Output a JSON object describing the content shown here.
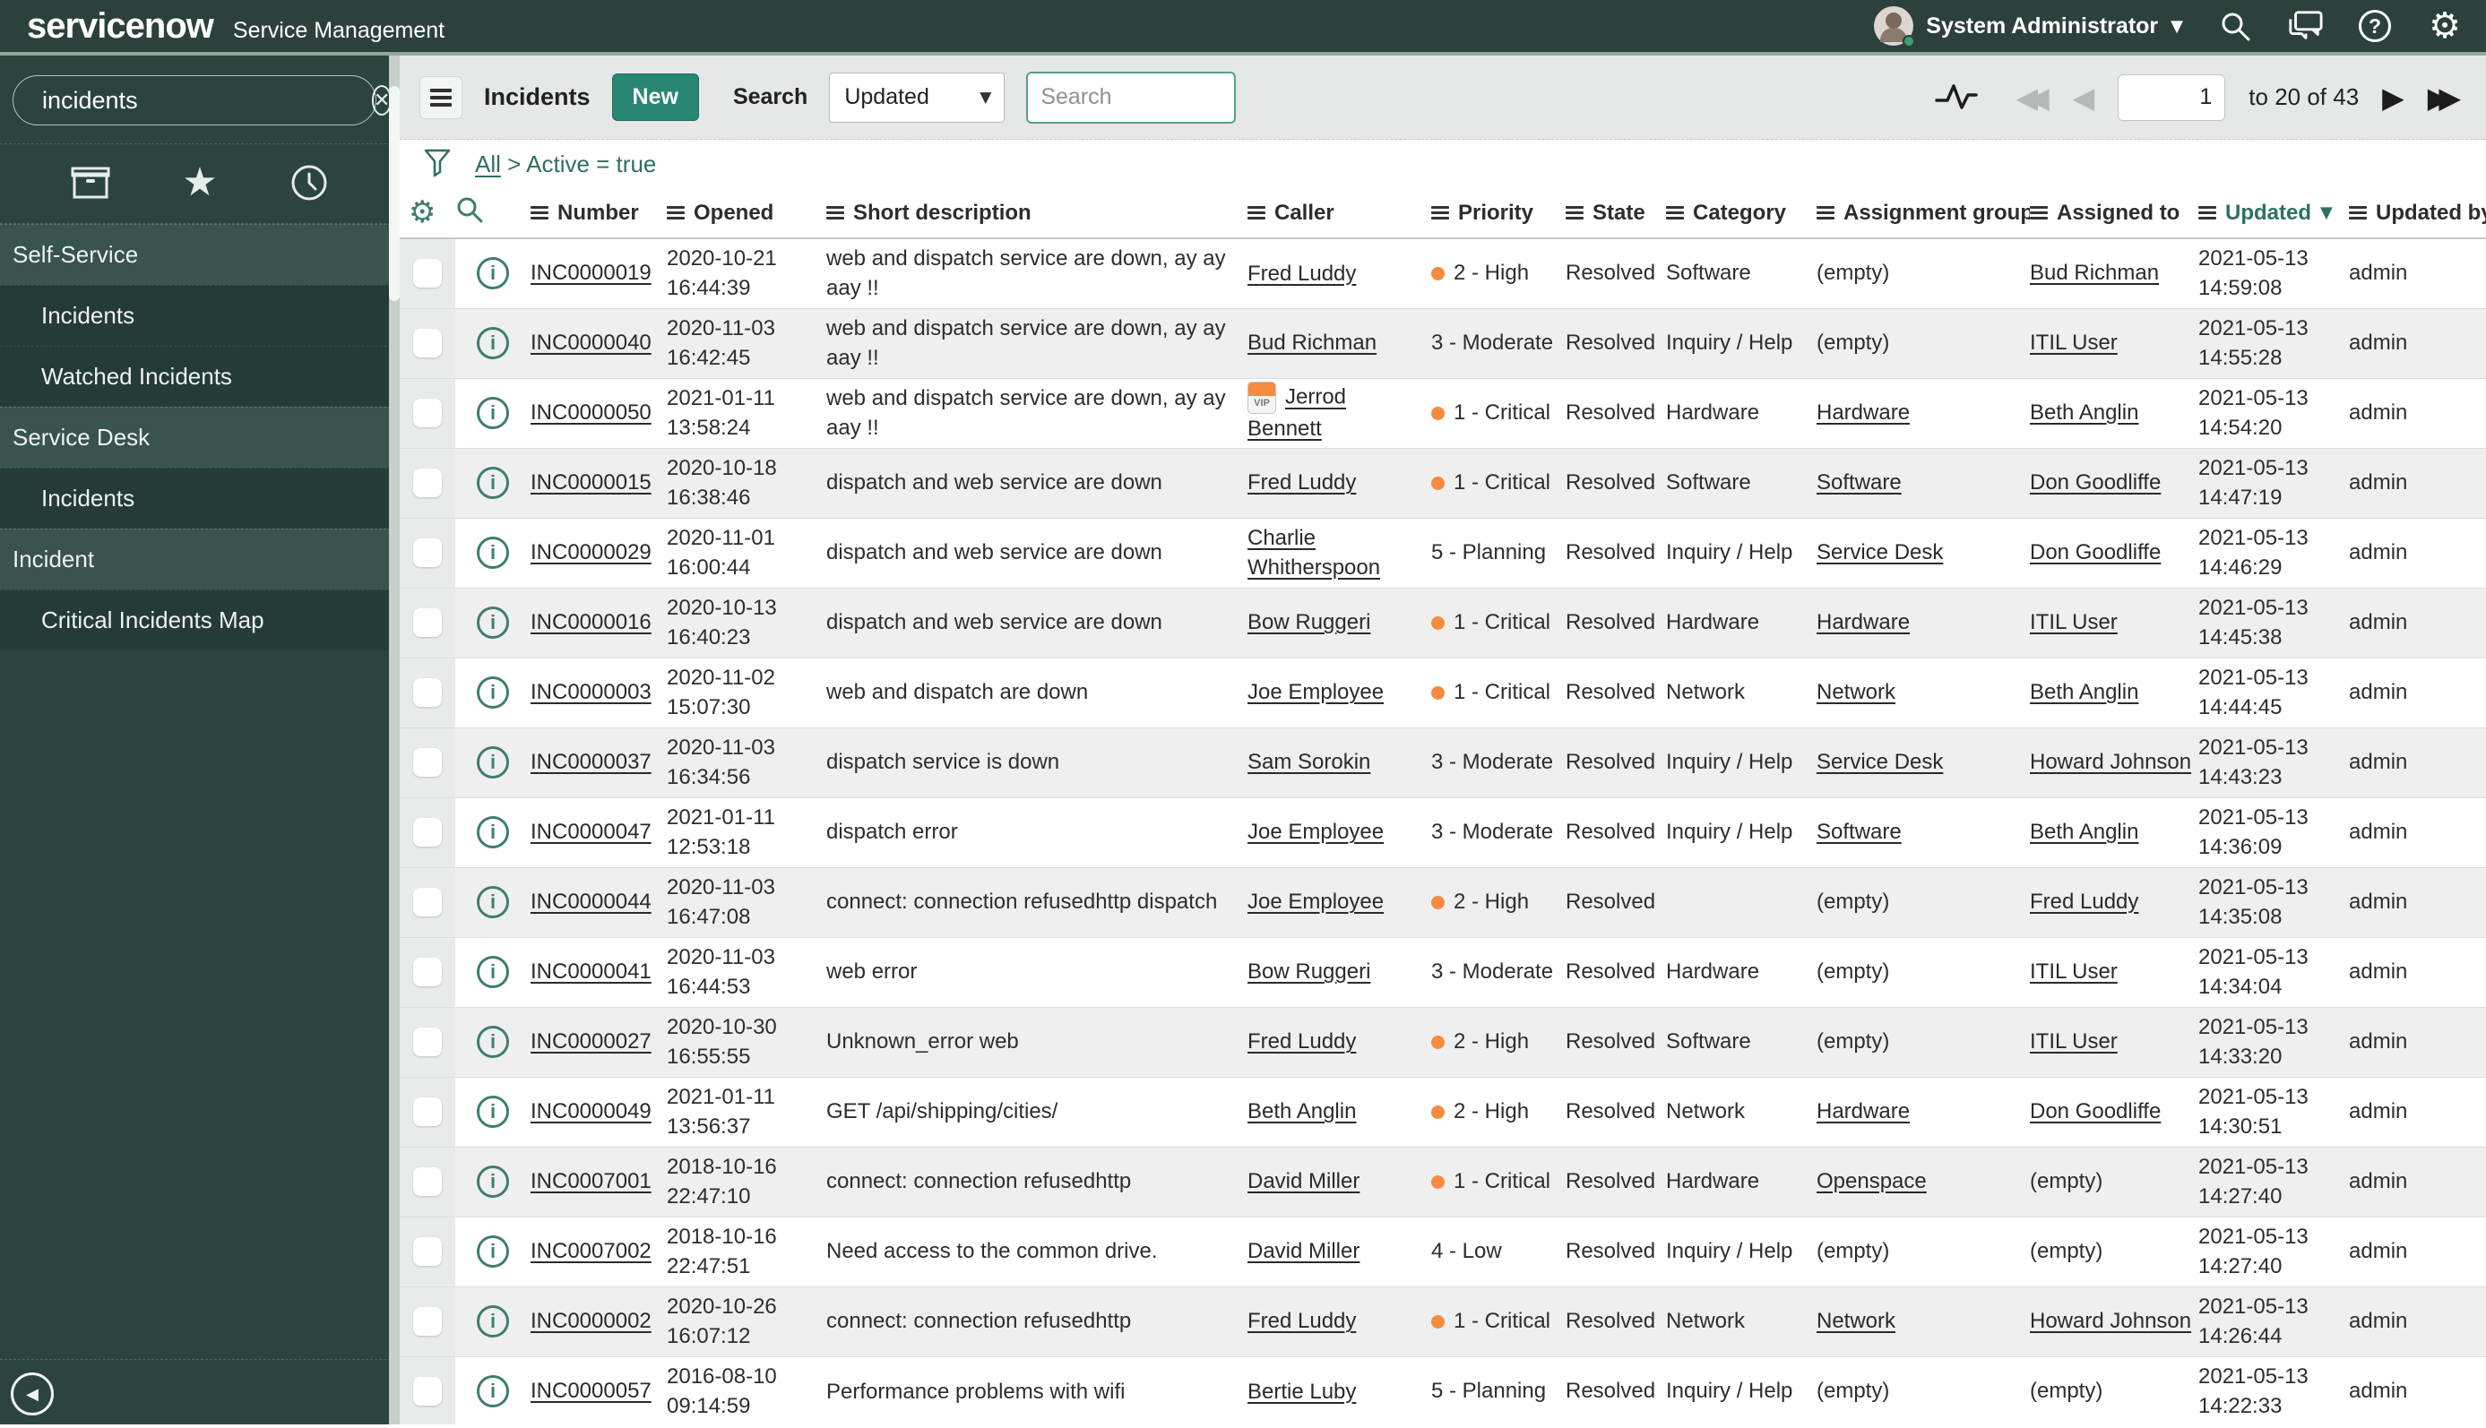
{
  "colors": {
    "header_bg": "#2c403e",
    "sidebar_bg": "#2b4440",
    "brand_green": "#278770",
    "accent_teal": "#3e7d70",
    "priority_orange": "#f68b3e"
  },
  "header": {
    "logo": "servicenow",
    "product": "Service Management",
    "user": "System Administrator"
  },
  "sidebar": {
    "filter_value": "incidents",
    "nav": [
      {
        "type": "section",
        "label": "Self-Service"
      },
      {
        "type": "item",
        "label": "Incidents"
      },
      {
        "type": "item",
        "label": "Watched Incidents"
      },
      {
        "type": "section",
        "label": "Service Desk"
      },
      {
        "type": "item",
        "label": "Incidents"
      },
      {
        "type": "section",
        "label": "Incident"
      },
      {
        "type": "item",
        "label": "Critical Incidents Map"
      }
    ]
  },
  "toolbar": {
    "title": "Incidents",
    "new_label": "New",
    "search_label": "Search",
    "search_field": "Updated",
    "search_placeholder": "Search",
    "page_value": "1",
    "page_info": "to 20 of 43"
  },
  "breadcrumb": {
    "root": "All",
    "separator": ">",
    "condition": "Active = true"
  },
  "table": {
    "columns": [
      "Number",
      "Opened",
      "Short description",
      "Caller",
      "Priority",
      "State",
      "Category",
      "Assignment group",
      "Assigned to",
      "Updated",
      "Updated by"
    ],
    "sorted_column": "Updated",
    "sort_indicator": "▼",
    "vip_label": "VIP",
    "empty_label": "(empty)",
    "rows": [
      {
        "number": "INC0000019",
        "opened": "2020-10-21 16:44:39",
        "short_description": "web and dispatch service are down, ay ay aay !!",
        "caller": "Fred Luddy",
        "vip": false,
        "priority": "2 - High",
        "priority_dot": true,
        "state": "Resolved",
        "category": "Software",
        "assignment_group": "(empty)",
        "assignment_group_is_link": false,
        "assigned_to": "Bud Richman",
        "assigned_to_is_link": true,
        "updated": "2021-05-13 14:59:08",
        "updated_by": "admin"
      },
      {
        "number": "INC0000040",
        "opened": "2020-11-03 16:42:45",
        "short_description": "web and dispatch service are down, ay ay aay !!",
        "caller": "Bud Richman",
        "vip": false,
        "priority": "3 - Moderate",
        "priority_dot": false,
        "state": "Resolved",
        "category": "Inquiry / Help",
        "assignment_group": "(empty)",
        "assignment_group_is_link": false,
        "assigned_to": "ITIL User",
        "assigned_to_is_link": true,
        "updated": "2021-05-13 14:55:28",
        "updated_by": "admin"
      },
      {
        "number": "INC0000050",
        "opened": "2021-01-11 13:58:24",
        "short_description": "web and dispatch service are down, ay ay aay !!",
        "caller": "Jerrod Bennett",
        "vip": true,
        "priority": "1 - Critical",
        "priority_dot": true,
        "state": "Resolved",
        "category": "Hardware",
        "assignment_group": "Hardware",
        "assignment_group_is_link": true,
        "assigned_to": "Beth Anglin",
        "assigned_to_is_link": true,
        "updated": "2021-05-13 14:54:20",
        "updated_by": "admin"
      },
      {
        "number": "INC0000015",
        "opened": "2020-10-18 16:38:46",
        "short_description": "dispatch and web service are down",
        "caller": "Fred Luddy",
        "vip": false,
        "priority": "1 - Critical",
        "priority_dot": true,
        "state": "Resolved",
        "category": "Software",
        "assignment_group": "Software",
        "assignment_group_is_link": true,
        "assigned_to": "Don Goodliffe",
        "assigned_to_is_link": true,
        "updated": "2021-05-13 14:47:19",
        "updated_by": "admin"
      },
      {
        "number": "INC0000029",
        "opened": "2020-11-01 16:00:44",
        "short_description": "dispatch and web service are down",
        "caller": "Charlie Whitherspoon",
        "vip": false,
        "priority": "5 - Planning",
        "priority_dot": false,
        "state": "Resolved",
        "category": "Inquiry / Help",
        "assignment_group": "Service Desk",
        "assignment_group_is_link": true,
        "assigned_to": "Don Goodliffe",
        "assigned_to_is_link": true,
        "updated": "2021-05-13 14:46:29",
        "updated_by": "admin"
      },
      {
        "number": "INC0000016",
        "opened": "2020-10-13 16:40:23",
        "short_description": "dispatch and web service are down",
        "caller": "Bow Ruggeri",
        "vip": false,
        "priority": "1 - Critical",
        "priority_dot": true,
        "state": "Resolved",
        "category": "Hardware",
        "assignment_group": "Hardware",
        "assignment_group_is_link": true,
        "assigned_to": "ITIL User",
        "assigned_to_is_link": true,
        "updated": "2021-05-13 14:45:38",
        "updated_by": "admin"
      },
      {
        "number": "INC0000003",
        "opened": "2020-11-02 15:07:30",
        "short_description": "web and dispatch are down",
        "caller": "Joe Employee",
        "vip": false,
        "priority": "1 - Critical",
        "priority_dot": true,
        "state": "Resolved",
        "category": "Network",
        "assignment_group": "Network",
        "assignment_group_is_link": true,
        "assigned_to": "Beth Anglin",
        "assigned_to_is_link": true,
        "updated": "2021-05-13 14:44:45",
        "updated_by": "admin"
      },
      {
        "number": "INC0000037",
        "opened": "2020-11-03 16:34:56",
        "short_description": "dispatch service is down",
        "caller": "Sam Sorokin",
        "vip": false,
        "priority": "3 - Moderate",
        "priority_dot": false,
        "state": "Resolved",
        "category": "Inquiry / Help",
        "assignment_group": "Service Desk",
        "assignment_group_is_link": true,
        "assigned_to": "Howard Johnson",
        "assigned_to_is_link": true,
        "updated": "2021-05-13 14:43:23",
        "updated_by": "admin"
      },
      {
        "number": "INC0000047",
        "opened": "2021-01-11 12:53:18",
        "short_description": "dispatch error",
        "caller": "Joe Employee",
        "vip": false,
        "priority": "3 - Moderate",
        "priority_dot": false,
        "state": "Resolved",
        "category": "Inquiry / Help",
        "assignment_group": "Software",
        "assignment_group_is_link": true,
        "assigned_to": "Beth Anglin",
        "assigned_to_is_link": true,
        "updated": "2021-05-13 14:36:09",
        "updated_by": "admin"
      },
      {
        "number": "INC0000044",
        "opened": "2020-11-03 16:47:08",
        "short_description": "connect: connection refusedhttp dispatch",
        "caller": "Joe Employee",
        "vip": false,
        "priority": "2 - High",
        "priority_dot": true,
        "state": "Resolved",
        "category": "",
        "assignment_group": "(empty)",
        "assignment_group_is_link": false,
        "assigned_to": "Fred Luddy",
        "assigned_to_is_link": true,
        "updated": "2021-05-13 14:35:08",
        "updated_by": "admin"
      },
      {
        "number": "INC0000041",
        "opened": "2020-11-03 16:44:53",
        "short_description": "web error",
        "caller": "Bow Ruggeri",
        "vip": false,
        "priority": "3 - Moderate",
        "priority_dot": false,
        "state": "Resolved",
        "category": "Hardware",
        "assignment_group": "(empty)",
        "assignment_group_is_link": false,
        "assigned_to": "ITIL User",
        "assigned_to_is_link": true,
        "updated": "2021-05-13 14:34:04",
        "updated_by": "admin"
      },
      {
        "number": "INC0000027",
        "opened": "2020-10-30 16:55:55",
        "short_description": "Unknown_error web",
        "caller": "Fred Luddy",
        "vip": false,
        "priority": "2 - High",
        "priority_dot": true,
        "state": "Resolved",
        "category": "Software",
        "assignment_group": "(empty)",
        "assignment_group_is_link": false,
        "assigned_to": "ITIL User",
        "assigned_to_is_link": true,
        "updated": "2021-05-13 14:33:20",
        "updated_by": "admin"
      },
      {
        "number": "INC0000049",
        "opened": "2021-01-11 13:56:37",
        "short_description": "GET /api/shipping/cities/",
        "caller": "Beth Anglin",
        "vip": false,
        "priority": "2 - High",
        "priority_dot": true,
        "state": "Resolved",
        "category": "Network",
        "assignment_group": "Hardware",
        "assignment_group_is_link": true,
        "assigned_to": "Don Goodliffe",
        "assigned_to_is_link": true,
        "updated": "2021-05-13 14:30:51",
        "updated_by": "admin"
      },
      {
        "number": "INC0007001",
        "opened": "2018-10-16 22:47:10",
        "short_description": "connect: connection refusedhttp",
        "caller": "David Miller",
        "vip": false,
        "priority": "1 - Critical",
        "priority_dot": true,
        "state": "Resolved",
        "category": "Hardware",
        "assignment_group": "Openspace",
        "assignment_group_is_link": true,
        "assigned_to": "(empty)",
        "assigned_to_is_link": false,
        "updated": "2021-05-13 14:27:40",
        "updated_by": "admin"
      },
      {
        "number": "INC0007002",
        "opened": "2018-10-16 22:47:51",
        "short_description": "Need access to the common drive.",
        "caller": "David Miller",
        "vip": false,
        "priority": "4 - Low",
        "priority_dot": false,
        "state": "Resolved",
        "category": "Inquiry / Help",
        "assignment_group": "(empty)",
        "assignment_group_is_link": false,
        "assigned_to": "(empty)",
        "assigned_to_is_link": false,
        "updated": "2021-05-13 14:27:40",
        "updated_by": "admin"
      },
      {
        "number": "INC0000002",
        "opened": "2020-10-26 16:07:12",
        "short_description": "connect: connection refusedhttp",
        "caller": "Fred Luddy",
        "vip": false,
        "priority": "1 - Critical",
        "priority_dot": true,
        "state": "Resolved",
        "category": "Network",
        "assignment_group": "Network",
        "assignment_group_is_link": true,
        "assigned_to": "Howard Johnson",
        "assigned_to_is_link": true,
        "updated": "2021-05-13 14:26:44",
        "updated_by": "admin"
      },
      {
        "number": "INC0000057",
        "opened": "2016-08-10 09:14:59",
        "short_description": "Performance problems with wifi",
        "caller": "Bertie Luby",
        "vip": false,
        "priority": "5 - Planning",
        "priority_dot": false,
        "state": "Resolved",
        "category": "Inquiry / Help",
        "assignment_group": "(empty)",
        "assignment_group_is_link": false,
        "assigned_to": "(empty)",
        "assigned_to_is_link": false,
        "updated": "2021-05-13 14:22:33",
        "updated_by": "admin"
      }
    ]
  }
}
